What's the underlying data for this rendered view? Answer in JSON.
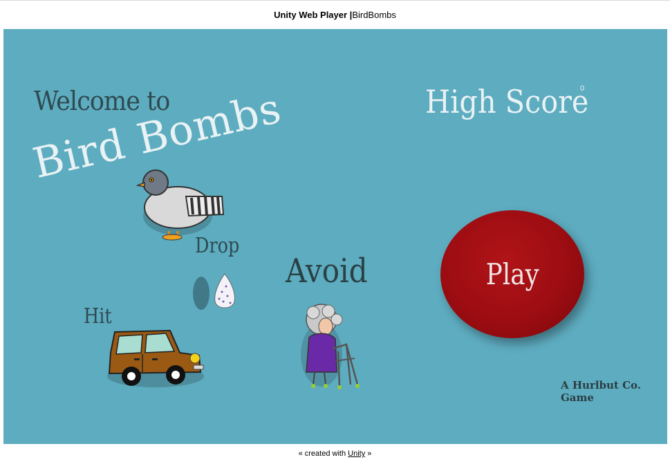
{
  "window": {
    "title_bold": "Unity Web Player |",
    "title_rest": " BirdBombs"
  },
  "menu": {
    "welcome": "Welcome to",
    "game_title": "Bird Bombs",
    "high_score_label": "High Score",
    "high_score_value": "0",
    "drop_label": "Drop",
    "avoid_label": "Avoid",
    "hit_label": "Hit",
    "play_button": "Play",
    "credit": "A Hurlbut Co. Game"
  },
  "sprites": {
    "bird": "pigeon-icon",
    "dropping": "bird-dropping-icon",
    "car": "car-icon",
    "grandma": "old-woman-walker-icon"
  },
  "colors": {
    "background": "#5eacc0",
    "play_button": "#9c0d12",
    "title_text": "#e9f2f4",
    "dark_text": "#2f4a50"
  },
  "footer": {
    "prefix": "« created with ",
    "link": "Unity",
    "suffix": " »"
  }
}
